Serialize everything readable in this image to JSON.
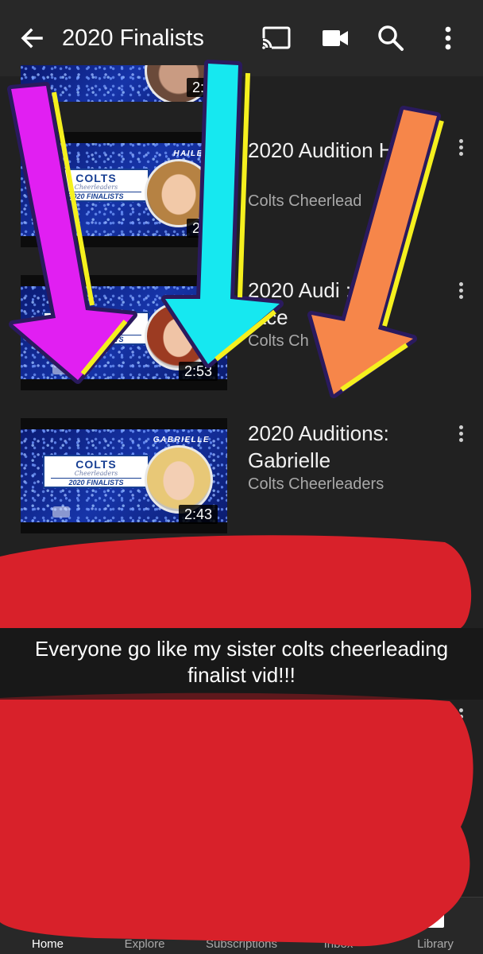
{
  "header": {
    "title": "2020 Finalists",
    "back_icon": "arrow-left-icon",
    "actions": [
      "cast-icon",
      "camera-icon",
      "search-icon",
      "more-vert-icon"
    ]
  },
  "videos": [
    {
      "title": "",
      "channel": "",
      "duration": "2:5",
      "thumb_caption": ""
    },
    {
      "title": "2020 Audition Hailey",
      "channel": "Colts Cheerlead",
      "duration": "2:3",
      "thumb_caption": "HAILEY"
    },
    {
      "title": "2020 Audi :",
      "title2": "race",
      "channel": "Colts Ch",
      "duration": "2:53",
      "thumb_caption": ""
    },
    {
      "title": "2020 Auditions:",
      "title2": "Gabrielle",
      "channel": "Colts Cheerleaders",
      "duration": "2:43",
      "thumb_caption": "GABRIELLE"
    }
  ],
  "thumb_logo": {
    "line1": "COLTS",
    "line2": "Cheerleaders",
    "line3": "2020 FINALISTS"
  },
  "caption": "Everyone go like my sister colts cheerleading finalist vid!!!",
  "overlay_colors": {
    "arrow1": "#e11ff2",
    "arrow2": "#16e8f0",
    "arrow3": "#f6864a",
    "outline": "#2a1a5e",
    "stripe": "#f5f01e",
    "scribble": "#d8212a"
  },
  "bottom_nav": [
    {
      "label": "Home",
      "icon": "home-icon",
      "active": true
    },
    {
      "label": "Explore",
      "icon": "compass-icon"
    },
    {
      "label": "Subscriptions",
      "icon": "subscriptions-icon"
    },
    {
      "label": "Inbox",
      "icon": "bell-icon"
    },
    {
      "label": "Library",
      "icon": "library-icon"
    }
  ]
}
